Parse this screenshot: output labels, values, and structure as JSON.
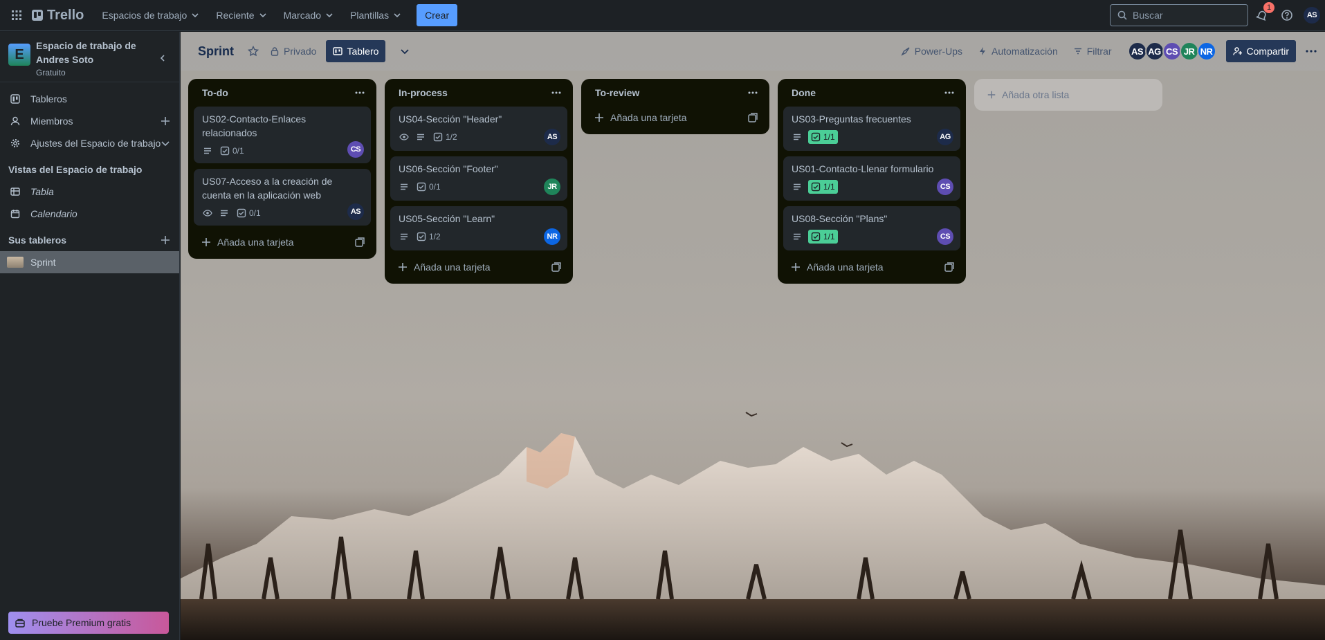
{
  "topbar": {
    "logo": "Trello",
    "nav": [
      {
        "label": "Espacios de trabajo"
      },
      {
        "label": "Reciente"
      },
      {
        "label": "Marcado"
      },
      {
        "label": "Plantillas"
      }
    ],
    "create_label": "Crear",
    "search_placeholder": "Buscar",
    "notification_count": "1",
    "user_initials": "AS"
  },
  "sidebar": {
    "workspace_initial": "E",
    "workspace_name": "Espacio de trabajo de Andres Soto",
    "workspace_plan": "Gratuito",
    "items": [
      {
        "label": "Tableros"
      },
      {
        "label": "Miembros"
      },
      {
        "label": "Ajustes del Espacio de trabajo"
      }
    ],
    "views_heading": "Vistas del Espacio de trabajo",
    "views": [
      {
        "label": "Tabla"
      },
      {
        "label": "Calendario"
      }
    ],
    "boards_heading": "Sus tableros",
    "boards": [
      {
        "label": "Sprint"
      }
    ],
    "premium_label": "Pruebe Premium gratis"
  },
  "boardbar": {
    "title": "Sprint",
    "visibility": "Privado",
    "view": "Tablero",
    "powerups": "Power-Ups",
    "automation": "Automatización",
    "filter": "Filtrar",
    "members": [
      {
        "initials": "AS",
        "color": "#1d2b4a"
      },
      {
        "initials": "AG",
        "color": "#1d2b4a"
      },
      {
        "initials": "CS",
        "color": "#5e4db2"
      },
      {
        "initials": "JR",
        "color": "#1f845a"
      },
      {
        "initials": "NR",
        "color": "#0c66e4"
      }
    ],
    "share": "Compartir"
  },
  "lists": [
    {
      "title": "To-do",
      "cards": [
        {
          "title": "US02-Contacto-Enlaces relacionados",
          "checklist": "0/1",
          "member": "CS"
        },
        {
          "title": "US07-Acceso a la creación de cuenta en la aplicación web",
          "checklist": "0/1",
          "member": "AS"
        }
      ]
    },
    {
      "title": "In-process",
      "cards": [
        {
          "title": "US04-Sección \"Header\"",
          "checklist": "1/2",
          "member": "AS"
        },
        {
          "title": "US06-Sección \"Footer\"",
          "checklist": "0/1",
          "member": "JR"
        },
        {
          "title": "US05-Sección \"Learn\"",
          "checklist": "1/2",
          "member": "NR"
        }
      ]
    },
    {
      "title": "To-review",
      "cards": []
    },
    {
      "title": "Done",
      "cards": [
        {
          "title": "US03-Preguntas frecuentes",
          "checklist": "1/1",
          "member": "AG"
        },
        {
          "title": "US01-Contacto-Llenar formulario",
          "checklist": "1/1",
          "member": "CS"
        },
        {
          "title": "US08-Sección \"Plans\"",
          "checklist": "1/1",
          "member": "CS"
        }
      ]
    }
  ],
  "add_card_label": "Añada una tarjeta",
  "add_list_label": "Añada otra lista",
  "colors": {
    "accent": "#579dff",
    "done_badge": "#4bce97",
    "list_bg": "#101204",
    "card_bg": "#22272b"
  }
}
